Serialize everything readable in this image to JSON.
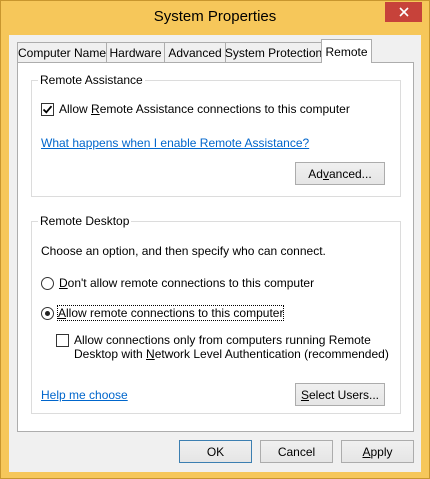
{
  "window": {
    "title": "System Properties"
  },
  "tabs": [
    {
      "label": "Computer Name",
      "active": false
    },
    {
      "label": "Hardware",
      "active": false
    },
    {
      "label": "Advanced",
      "active": false
    },
    {
      "label": "System Protection",
      "active": false
    },
    {
      "label": "Remote",
      "active": true
    }
  ],
  "remote_assistance": {
    "group_label": "Remote Assistance",
    "allow_checkbox": {
      "checked": true,
      "pre": "Allow ",
      "ul": "R",
      "post": "emote Assistance connections to this computer"
    },
    "help_link": "What happens when I enable Remote Assistance?",
    "advanced_button": {
      "pre": "Ad",
      "ul": "v",
      "post": "anced..."
    }
  },
  "remote_desktop": {
    "group_label": "Remote Desktop",
    "instruction": "Choose an option, and then specify who can connect.",
    "option_dont_allow": {
      "selected": false,
      "pre": "",
      "ul": "D",
      "post": "on't allow remote connections to this computer"
    },
    "option_allow": {
      "selected": true,
      "pre": "",
      "ul": "A",
      "post": "llow remote connections to this computer"
    },
    "nla_checkbox": {
      "checked": false,
      "line1": "Allow connections only from computers running Remote",
      "line2_pre": "Desktop with ",
      "line2_ul": "N",
      "line2_post": "etwork Level Authentication (recommended)"
    },
    "help_link": "Help me choose",
    "select_users_button": {
      "pre": "",
      "ul": "S",
      "post": "elect Users..."
    }
  },
  "footer": {
    "ok": "OK",
    "cancel": "Cancel",
    "apply": {
      "pre": "",
      "ul": "A",
      "post": "pply"
    }
  }
}
